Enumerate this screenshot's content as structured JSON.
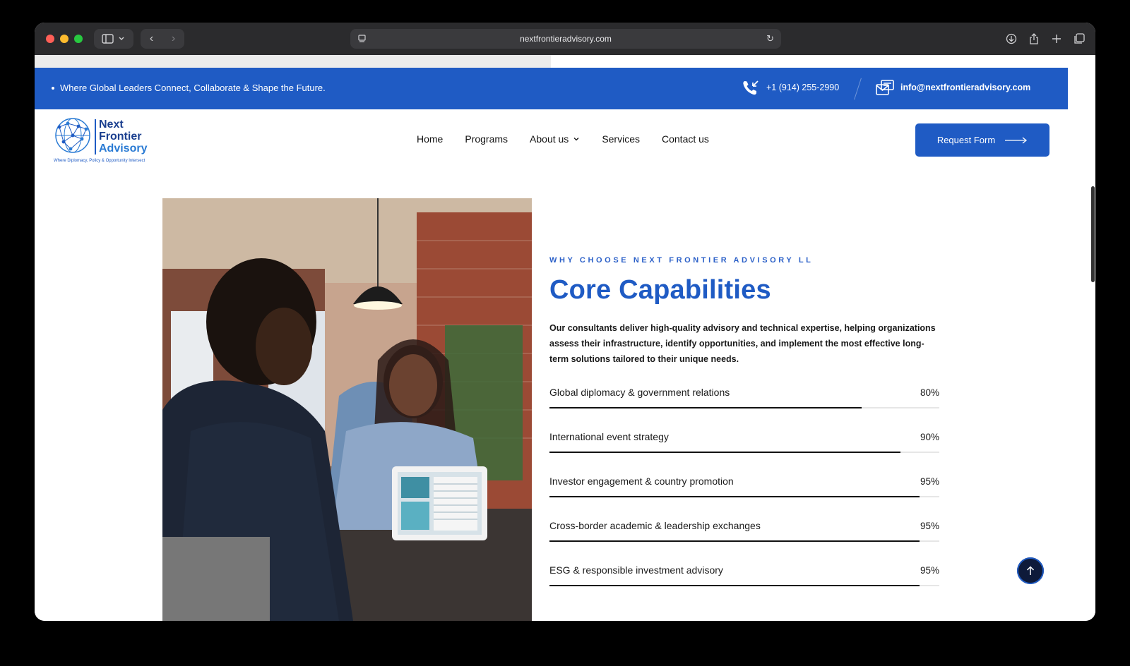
{
  "browser": {
    "url": "nextfrontieradvisory.com"
  },
  "topbar": {
    "tagline": "Where Global Leaders Connect, Collaborate & Shape the Future.",
    "phone": "+1 (914) 255-2990",
    "email": "info@nextfrontieradvisory.com"
  },
  "logo": {
    "line1": "Next",
    "line2": "Frontier",
    "line3": "Advisory",
    "subtitle": "Where Diplomacy, Policy & Opportunity Intersect"
  },
  "nav": {
    "items": [
      {
        "label": "Home"
      },
      {
        "label": "Programs"
      },
      {
        "label": "About us"
      },
      {
        "label": "Services"
      },
      {
        "label": "Contact us"
      }
    ],
    "request_button": "Request Form"
  },
  "section": {
    "eyebrow": "WHY CHOOSE NEXT FRONTIER ADVISORY LL",
    "title": "Core Capabilities",
    "description": "Our consultants deliver high-quality advisory and technical expertise, helping organizations assess their infrastructure, identify opportunities, and implement the most effective long-term solutions tailored to their unique needs."
  },
  "skills": [
    {
      "label": "Global diplomacy & government relations",
      "percent_text": "80%",
      "value": 0.8
    },
    {
      "label": "International event strategy",
      "percent_text": "90%",
      "value": 0.9
    },
    {
      "label": "Investor engagement & country promotion",
      "percent_text": "95%",
      "value": 0.95
    },
    {
      "label": "Cross-border academic & leadership exchanges",
      "percent_text": "95%",
      "value": 0.95
    },
    {
      "label": "ESG & responsible investment advisory",
      "percent_text": "95%",
      "value": 0.95
    }
  ],
  "colors": {
    "brand_blue": "#1f5bc4",
    "text_dark": "#1a1a1a",
    "back_to_top": "#0e1a3a"
  },
  "icons": {
    "phone": "phone-incoming-icon",
    "email": "envelope-icon",
    "arrow": "long-arrow-right-icon",
    "back_to_top": "arrow-up-icon"
  }
}
